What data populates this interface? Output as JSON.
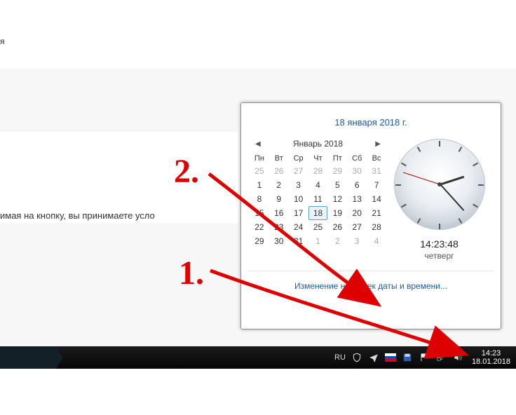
{
  "page": {
    "ya_text": "я",
    "terms_text": "имая на кнопку, вы принимаете усло"
  },
  "popup": {
    "date_header": "18 января 2018 г.",
    "month_label": "Январь 2018",
    "weekdays": [
      "Пн",
      "Вт",
      "Ср",
      "Чт",
      "Пт",
      "Сб",
      "Вс"
    ],
    "calendar": [
      {
        "d": "25",
        "g": true
      },
      {
        "d": "26",
        "g": true
      },
      {
        "d": "27",
        "g": true
      },
      {
        "d": "28",
        "g": true
      },
      {
        "d": "29",
        "g": true
      },
      {
        "d": "30",
        "g": true
      },
      {
        "d": "31",
        "g": true
      },
      {
        "d": "1"
      },
      {
        "d": "2"
      },
      {
        "d": "3"
      },
      {
        "d": "4"
      },
      {
        "d": "5"
      },
      {
        "d": "6"
      },
      {
        "d": "7"
      },
      {
        "d": "8"
      },
      {
        "d": "9"
      },
      {
        "d": "10"
      },
      {
        "d": "11"
      },
      {
        "d": "12"
      },
      {
        "d": "13"
      },
      {
        "d": "14"
      },
      {
        "d": "15"
      },
      {
        "d": "16"
      },
      {
        "d": "17"
      },
      {
        "d": "18",
        "today": true
      },
      {
        "d": "19"
      },
      {
        "d": "20"
      },
      {
        "d": "21"
      },
      {
        "d": "22"
      },
      {
        "d": "23"
      },
      {
        "d": "24"
      },
      {
        "d": "25"
      },
      {
        "d": "26"
      },
      {
        "d": "27"
      },
      {
        "d": "28"
      },
      {
        "d": "29"
      },
      {
        "d": "30"
      },
      {
        "d": "31"
      },
      {
        "d": "1",
        "g": true
      },
      {
        "d": "2",
        "g": true
      },
      {
        "d": "3",
        "g": true
      },
      {
        "d": "4",
        "g": true
      }
    ],
    "clock_time": "14:23:48",
    "clock_day": "четверг",
    "change_link": "Изменение настроек даты и времени..."
  },
  "taskbar": {
    "lang": "RU",
    "time": "14:23",
    "date": "18.01.2018"
  },
  "annotations": {
    "n1": "1.",
    "n2": "2."
  }
}
